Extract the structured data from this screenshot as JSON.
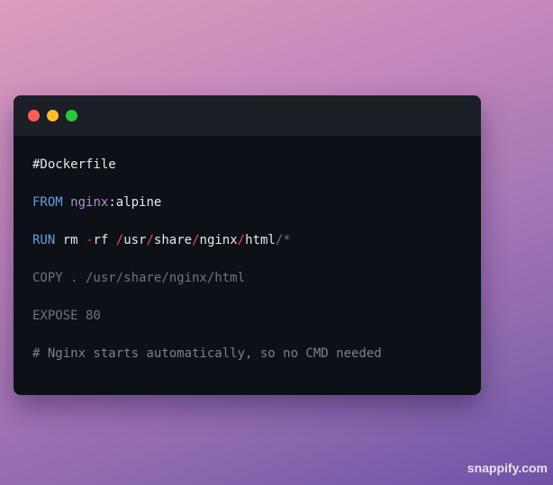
{
  "window": {
    "controls": {
      "close_color": "#ff5f57",
      "minimize_color": "#febc2e",
      "maximize_color": "#28c840"
    }
  },
  "code": {
    "line1": "#Dockerfile",
    "line2": {
      "keyword": "FROM",
      "space": " ",
      "image": "nginx",
      "rest": ":alpine"
    },
    "line3": {
      "keyword": "RUN",
      "cmd": " rm ",
      "flag_dash": "-",
      "flag": "rf ",
      "s1": "/",
      "p1": "usr",
      "s2": "/",
      "p2": "share",
      "s3": "/",
      "p3": "nginx",
      "s4": "/",
      "p4": "html",
      "tail": "/*"
    },
    "line4": "COPY . /usr/share/nginx/html",
    "line5": "EXPOSE 80",
    "line6": "# Nginx starts automatically, so no CMD needed"
  },
  "watermark": "snappify.com"
}
